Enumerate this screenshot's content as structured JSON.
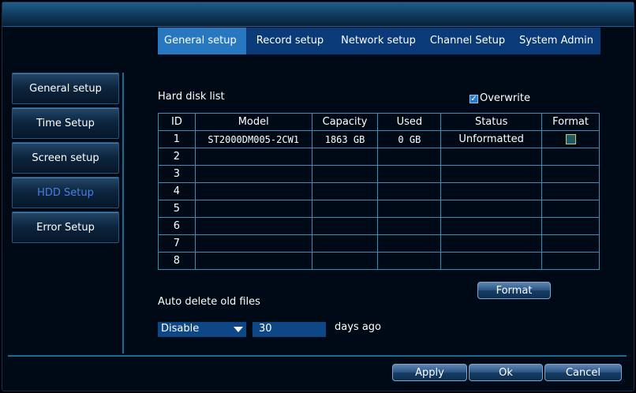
{
  "tabs": [
    "General setup",
    "Record setup",
    "Network setup",
    "Channel Setup",
    "System Admin"
  ],
  "sidebar": [
    "General setup",
    "Time Setup",
    "Screen setup",
    "HDD Setup",
    "Error Setup"
  ],
  "hdd": {
    "list_title": "Hard disk list",
    "overwrite_label": "Overwrite",
    "overwrite_checked": true,
    "columns": [
      "ID",
      "Model",
      "Capacity",
      "Used",
      "Status",
      "Format"
    ],
    "rows": [
      {
        "id": "1",
        "model": "ST2000DM005-2CW1",
        "capacity": "1863 GB",
        "used": "0 GB",
        "status": "Unformatted",
        "format_checkbox": true
      },
      {
        "id": "2",
        "model": "",
        "capacity": "",
        "used": "",
        "status": "",
        "format_checkbox": false
      },
      {
        "id": "3",
        "model": "",
        "capacity": "",
        "used": "",
        "status": "",
        "format_checkbox": false
      },
      {
        "id": "4",
        "model": "",
        "capacity": "",
        "used": "",
        "status": "",
        "format_checkbox": false
      },
      {
        "id": "5",
        "model": "",
        "capacity": "",
        "used": "",
        "status": "",
        "format_checkbox": false
      },
      {
        "id": "6",
        "model": "",
        "capacity": "",
        "used": "",
        "status": "",
        "format_checkbox": false
      },
      {
        "id": "7",
        "model": "",
        "capacity": "",
        "used": "",
        "status": "",
        "format_checkbox": false
      },
      {
        "id": "8",
        "model": "",
        "capacity": "",
        "used": "",
        "status": "",
        "format_checkbox": false
      }
    ],
    "format_button": "Format",
    "auto_delete_label": "Auto delete old files",
    "auto_delete_select": "Disable",
    "days_value": "30",
    "days_suffix": "days ago"
  },
  "footer": {
    "apply": "Apply",
    "ok": "Ok",
    "cancel": "Cancel"
  },
  "colors": {
    "active_tab": "#2778c0",
    "tab_bar": "#0a3a78",
    "active_side": "#4a7fe0",
    "grid": "#3a8fb4"
  }
}
